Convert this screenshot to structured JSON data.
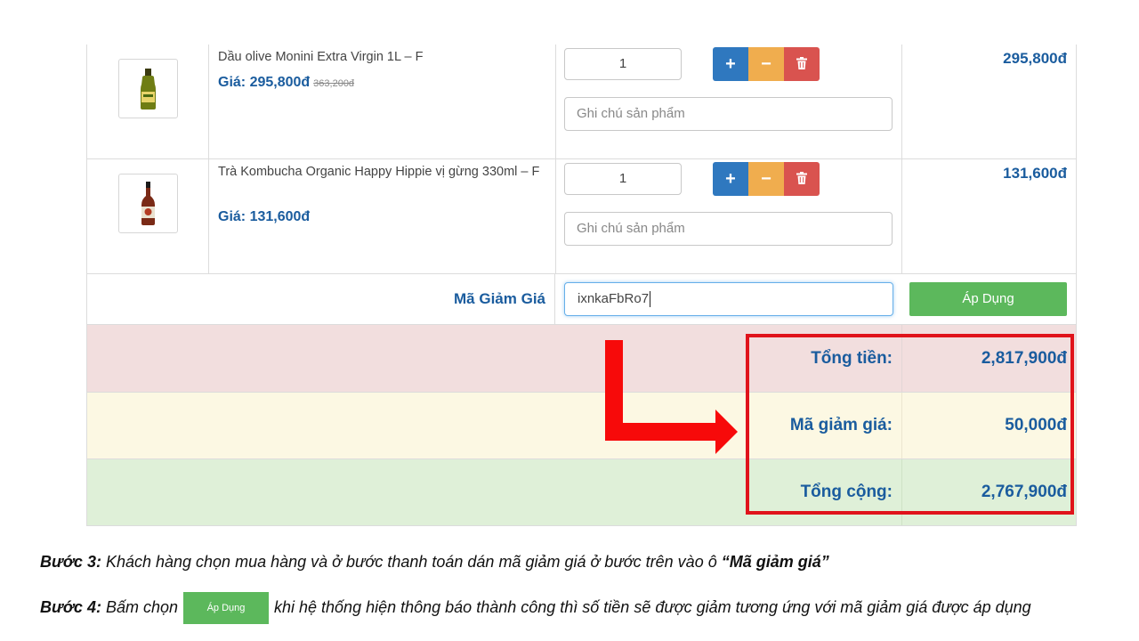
{
  "cart_items": [
    {
      "name": "Dầu olive Monini Extra Virgin 1L – F",
      "price_label": "Giá: 295,800đ",
      "old_price": "363,200đ",
      "quantity": "1",
      "note_placeholder": "Ghi chú sản phẩm",
      "line_total": "295,800đ",
      "thumbnail": "olive-oil-bottle-icon"
    },
    {
      "name": "Trà Kombucha Organic Happy Hippie vị gừng 330ml – F",
      "price_label": "Giá: 131,600đ",
      "old_price": "",
      "quantity": "1",
      "note_placeholder": "Ghi chú sản phẩm",
      "line_total": "131,600đ",
      "thumbnail": "kombucha-bottle-icon"
    }
  ],
  "buttons": {
    "plus": "+",
    "minus": "−",
    "delete_icon": "trash-icon"
  },
  "coupon": {
    "label": "Mã Giảm Giá",
    "value": "ixnkaFbRo7",
    "apply_label": "Áp Dụng"
  },
  "summary": {
    "subtotal_label": "Tổng tiền:",
    "subtotal_value": "2,817,900đ",
    "discount_label": "Mã giảm giá:",
    "discount_value": "50,000đ",
    "total_label": "Tổng cộng:",
    "total_value": "2,767,900đ"
  },
  "instructions": {
    "step3_prefix": "Bước 3:",
    "step3_text": " Khách hàng chọn mua hàng và ở bước thanh toán dán mã giảm giá ở bước trên vào ô ",
    "step3_quote": "“Mã giảm giá”",
    "step4_prefix": "Bước 4:",
    "step4_before": " Bấm chọn",
    "step4_button": "Áp Dụng",
    "step4_after": "khi hệ thống hiện thông báo thành công thì số tiền sẽ được giảm tương ứng với mã giảm giá được áp dụng"
  },
  "colors": {
    "primary_text": "#1a5c9e",
    "apply_green": "#5cb85c",
    "plus_blue": "#2f78bf",
    "minus_orange": "#f0ad4e",
    "delete_red": "#d9534f",
    "highlight_red": "#e0131b",
    "subtotal_bg": "#f2dede",
    "discount_bg": "#fcf8e3",
    "total_bg": "#dff0d8"
  }
}
